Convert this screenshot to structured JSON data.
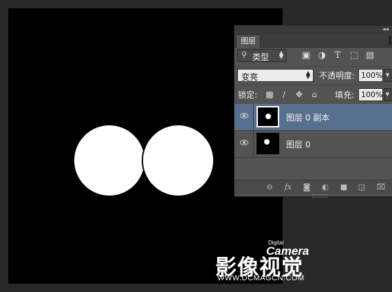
{
  "document": {
    "watermark": {
      "chinese": "影像视觉",
      "camera": "Camera",
      "digital": "Digital",
      "url": "WWW.DCMAGCN.COM"
    }
  },
  "layers_panel": {
    "tab_label": "图层",
    "filter": {
      "label": "类型",
      "search_icon": "magnifier-icon"
    },
    "filter_buttons": [
      "image-filter-icon",
      "adjustment-filter-icon",
      "type-filter-icon",
      "shape-filter-icon",
      "smart-object-filter-icon"
    ],
    "blend_mode": "变亮",
    "opacity_label": "不透明度:",
    "opacity_value": "100%",
    "lock_label": "锁定:",
    "lock_buttons": [
      "lock-pixels-icon",
      "lock-brush-icon",
      "lock-move-icon",
      "lock-all-icon"
    ],
    "fill_label": "填充:",
    "fill_value": "100%",
    "layers": [
      {
        "name": "图层 0 副本",
        "selected": true
      },
      {
        "name": "图层 0",
        "selected": false
      }
    ],
    "bottom_buttons": [
      "link-icon",
      "fx-icon",
      "mask-icon",
      "adjustment-icon",
      "folder-icon",
      "new-layer-icon",
      "trash-icon"
    ],
    "fx_label": "fx"
  },
  "colors": {
    "workspace": "#282828",
    "panel": "#535353",
    "selected_layer": "#58708f"
  }
}
